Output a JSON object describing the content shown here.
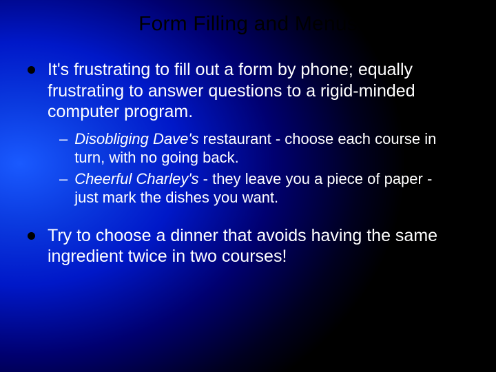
{
  "title": "Form Filling and Menus",
  "bullets": {
    "b1": "It's frustrating to fill out a form by phone; equally frustrating to answer questions to a rigid-minded computer program.",
    "s1": {
      "em": "Disobliging Dave's",
      "rest": " restaurant - choose each course in turn, with no going back."
    },
    "s2": {
      "em": "Cheerful Charley's",
      "rest": " - they leave you a piece of paper - just mark the dishes you want."
    },
    "b2": "Try to choose a dinner that avoids having the same ingredient twice in two courses!"
  }
}
